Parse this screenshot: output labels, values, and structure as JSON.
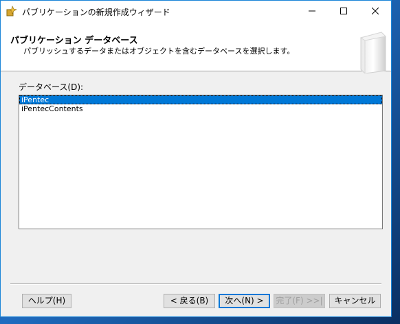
{
  "window": {
    "title": "パブリケーションの新規作成ウィザード"
  },
  "header": {
    "title": "パブリケーション データベース",
    "subtitle": "パブリッシュするデータまたはオブジェクトを含むデータベースを選択します。"
  },
  "database": {
    "label": "データベース(D):",
    "items": [
      "iPentec",
      "iPentecContents"
    ],
    "selected": "iPentec"
  },
  "buttons": {
    "help": "ヘルプ(H)",
    "back": "< 戻る(B)",
    "next": "次へ(N) >",
    "finish": "完了(F) >>|",
    "cancel": "キャンセル"
  }
}
